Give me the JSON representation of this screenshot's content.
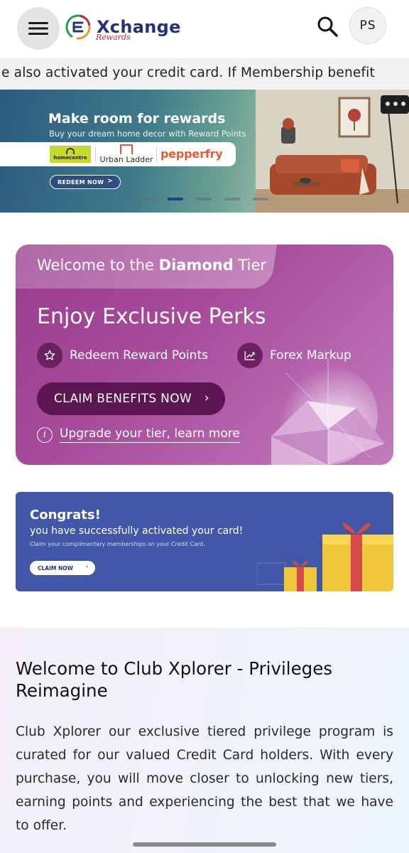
{
  "header": {
    "menu_icon": "hamburger-icon",
    "logo_title": "Xchange",
    "logo_sub": "Rewards",
    "search_icon": "search-icon",
    "avatar_initials": "PS"
  },
  "marquee": {
    "text": "e also activated your credit card. If Membership benefit"
  },
  "hero": {
    "title": "Make room for rewards",
    "subtitle": "Buy your dream home decor with Reward Points",
    "brands": [
      "homecentre",
      "Urban Ladder",
      "pepperfry"
    ],
    "cta": "REDEEM NOW",
    "cta_arrow": ">",
    "slides_total": 5,
    "active_slide": 2
  },
  "diamond": {
    "welcome_prefix": "Welcome to the",
    "tier_name": "Diamond",
    "tier_suffix": "Tier",
    "perks_title": "Enjoy Exclusive Perks",
    "perks": [
      {
        "label": "Redeem Reward Points",
        "icon": "star-icon"
      },
      {
        "label": "Forex Markup",
        "icon": "trend-up-icon"
      }
    ],
    "claim_label": "CLAIM BENEFITS NOW",
    "claim_chevron": "›",
    "upgrade_label": "Upgrade your tier, learn more",
    "info_icon": "info-icon"
  },
  "congrats": {
    "title": "Congrats!",
    "subtitle": "you have successfully activated your card!",
    "note": "Claim your complimentary memberships on your Credit Card.",
    "cta": "CLAIM NOW",
    "cta_arrow": "›"
  },
  "club": {
    "title": "Welcome to Club Xplorer - Privileges Reimagine",
    "body": "Club Xplorer our exclusive tiered privilege program is curated for our valued Credit Card holders. With every purchase, you will move closer to unlocking new tiers, earning points and experiencing the best that we have to offer."
  },
  "colors": {
    "brand_navy": "#22327a",
    "brand_red": "#c0282d",
    "diamond_purple": "#a64a99",
    "claim_dark": "#5c1752",
    "congrats_blue": "#4257a8"
  }
}
